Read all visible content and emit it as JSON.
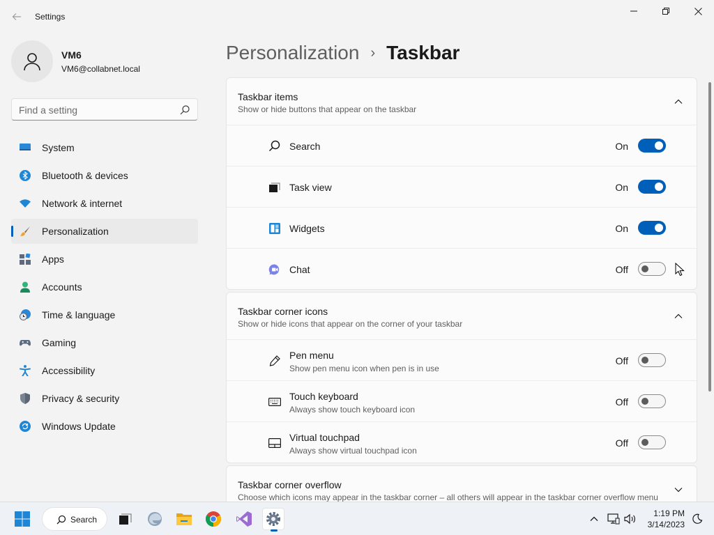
{
  "window": {
    "title": "Settings"
  },
  "profile": {
    "name": "VM6",
    "email": "VM6@collabnet.local"
  },
  "search": {
    "placeholder": "Find a setting"
  },
  "sidebar": {
    "items": [
      {
        "label": "System",
        "icon": "system-icon",
        "active": false
      },
      {
        "label": "Bluetooth & devices",
        "icon": "bluetooth-icon",
        "active": false
      },
      {
        "label": "Network & internet",
        "icon": "wifi-icon",
        "active": false
      },
      {
        "label": "Personalization",
        "icon": "brush-icon",
        "active": true
      },
      {
        "label": "Apps",
        "icon": "apps-icon",
        "active": false
      },
      {
        "label": "Accounts",
        "icon": "accounts-icon",
        "active": false
      },
      {
        "label": "Time & language",
        "icon": "clock-globe-icon",
        "active": false
      },
      {
        "label": "Gaming",
        "icon": "gamepad-icon",
        "active": false
      },
      {
        "label": "Accessibility",
        "icon": "accessibility-icon",
        "active": false
      },
      {
        "label": "Privacy & security",
        "icon": "shield-icon",
        "active": false
      },
      {
        "label": "Windows Update",
        "icon": "update-icon",
        "active": false
      }
    ]
  },
  "breadcrumb": {
    "parent": "Personalization",
    "separator": "›",
    "current": "Taskbar"
  },
  "sections": {
    "taskbar_items": {
      "title": "Taskbar items",
      "description": "Show or hide buttons that appear on the taskbar",
      "expanded": true,
      "rows": [
        {
          "label": "Search",
          "state": "On",
          "on": true,
          "icon": "search-icon"
        },
        {
          "label": "Task view",
          "state": "On",
          "on": true,
          "icon": "task-view-icon"
        },
        {
          "label": "Widgets",
          "state": "On",
          "on": true,
          "icon": "widgets-icon"
        },
        {
          "label": "Chat",
          "state": "Off",
          "on": false,
          "icon": "chat-icon"
        }
      ]
    },
    "corner_icons": {
      "title": "Taskbar corner icons",
      "description": "Show or hide icons that appear on the corner of your taskbar",
      "expanded": true,
      "rows": [
        {
          "label": "Pen menu",
          "sub": "Show pen menu icon when pen is in use",
          "state": "Off",
          "on": false,
          "icon": "pen-icon"
        },
        {
          "label": "Touch keyboard",
          "sub": "Always show touch keyboard icon",
          "state": "Off",
          "on": false,
          "icon": "keyboard-icon"
        },
        {
          "label": "Virtual touchpad",
          "sub": "Always show virtual touchpad icon",
          "state": "Off",
          "on": false,
          "icon": "touchpad-icon"
        }
      ]
    },
    "corner_overflow": {
      "title": "Taskbar corner overflow",
      "description": "Choose which icons may appear in the taskbar corner – all others will appear in the taskbar corner overflow menu",
      "expanded": false
    }
  },
  "taskbar": {
    "search_label": "Search",
    "apps": [
      "start-icon",
      "task-view-icon",
      "edge-icon",
      "file-explorer-icon",
      "chrome-icon",
      "visual-studio-icon",
      "settings-icon"
    ],
    "time": "1:19 PM",
    "date": "3/14/2023"
  },
  "colors": {
    "accent": "#005fb8",
    "background": "#f3f3f3",
    "card": "#fbfbfb"
  }
}
